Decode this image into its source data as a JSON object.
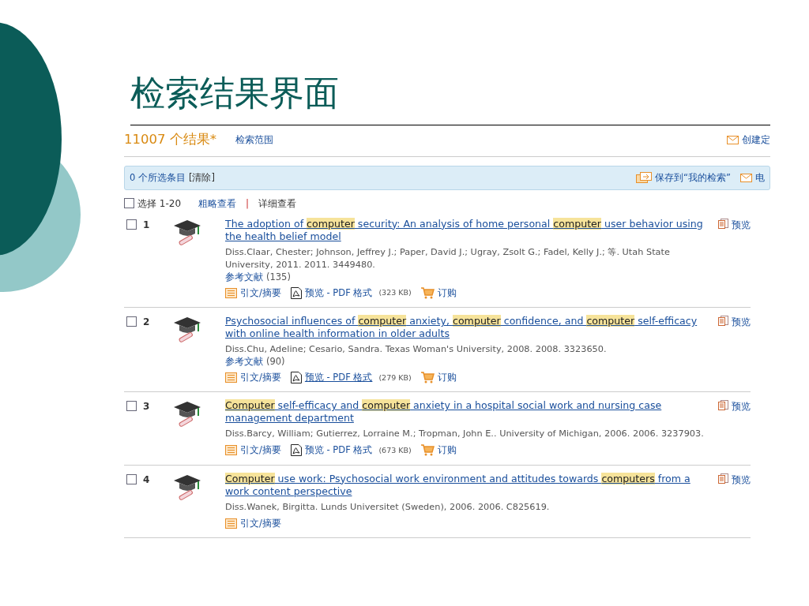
{
  "slide": {
    "title": "检索结果界面"
  },
  "results_header": {
    "count": "11007 个结果*",
    "scope_link": "检索范围",
    "create_link": "创建定"
  },
  "selection_bar": {
    "selected_text": "0 个所选条目",
    "clear_link": "[清除]",
    "save_link": "保存到“我的检索”",
    "email_link": "电"
  },
  "view_bar": {
    "select_all": {
      "label": "选择 1-20",
      "checked": false
    },
    "separator": "|",
    "views": [
      {
        "label": "粗略查看",
        "selected": false
      },
      {
        "label": "详细查看",
        "selected": true
      }
    ]
  },
  "results": [
    {
      "number": "1",
      "checked": false,
      "title": [
        {
          "text": "The adoption of ",
          "highlighted": false
        },
        {
          "text": "computer",
          "highlighted": true
        },
        {
          "text": " security: An analysis of home personal ",
          "highlighted": false
        },
        {
          "text": "computer",
          "highlighted": true
        },
        {
          "text": " user behavior using the health belief model",
          "highlighted": false
        }
      ],
      "preview": "预览",
      "meta": "Diss.Claar, Chester; Johnson, Jeffrey J.; Paper, David J.; Ugray, Zsolt G.; Fadel, Kelly J.; 等. Utah State University, 2011. 2011. 3449480.",
      "references": {
        "label": "参考文献",
        "count": "(135)"
      },
      "links": [
        {
          "kind": "abstract",
          "label": "引文/摘要"
        },
        {
          "kind": "pdf",
          "label": "预览 - PDF 格式",
          "size": "(323 KB)",
          "underlined": false
        },
        {
          "kind": "order",
          "label": "订购"
        }
      ]
    },
    {
      "number": "2",
      "checked": false,
      "title": [
        {
          "text": "Psychosocial influences of ",
          "highlighted": false
        },
        {
          "text": "computer",
          "highlighted": true
        },
        {
          "text": " anxiety, ",
          "highlighted": false
        },
        {
          "text": "computer",
          "highlighted": true
        },
        {
          "text": " confidence, and ",
          "highlighted": false
        },
        {
          "text": "computer",
          "highlighted": true
        },
        {
          "text": " self-efficacy with online health information in older adults",
          "highlighted": false
        }
      ],
      "preview": "预览",
      "meta": "Diss.Chu, Adeline; Cesario, Sandra. Texas Woman's University, 2008. 2008. 3323650.",
      "references": {
        "label": "参考文献",
        "count": "(90)"
      },
      "links": [
        {
          "kind": "abstract",
          "label": "引文/摘要"
        },
        {
          "kind": "pdf",
          "label": "预览 - PDF 格式",
          "size": "(279 KB)",
          "underlined": true
        },
        {
          "kind": "order",
          "label": "订购"
        }
      ]
    },
    {
      "number": "3",
      "checked": false,
      "title": [
        {
          "text": "Computer",
          "highlighted": true
        },
        {
          "text": " self-efficacy and ",
          "highlighted": false
        },
        {
          "text": "computer",
          "highlighted": true
        },
        {
          "text": " anxiety in a hospital social work and nursing case management department",
          "highlighted": false
        }
      ],
      "preview": "预览",
      "meta": "Diss.Barcy, William; Gutierrez, Lorraine M.; Tropman, John E.. University of Michigan, 2006. 2006. 3237903.",
      "links": [
        {
          "kind": "abstract",
          "label": "引文/摘要"
        },
        {
          "kind": "pdf",
          "label": "预览 - PDF 格式",
          "size": "(673 KB)",
          "underlined": false
        },
        {
          "kind": "order",
          "label": "订购"
        }
      ]
    },
    {
      "number": "4",
      "checked": false,
      "title": [
        {
          "text": "Computer",
          "highlighted": true
        },
        {
          "text": " use work: Psychosocial work environment and attitudes towards ",
          "highlighted": false
        },
        {
          "text": "computers",
          "highlighted": true
        },
        {
          "text": " from a work content perspective",
          "highlighted": false
        }
      ],
      "preview": "预览",
      "meta": "Diss.Wanek, Birgitta. Lunds Universitet (Sweden), 2006. 2006. C825619.",
      "links": [
        {
          "kind": "abstract",
          "label": "引文/摘要"
        }
      ]
    }
  ]
}
